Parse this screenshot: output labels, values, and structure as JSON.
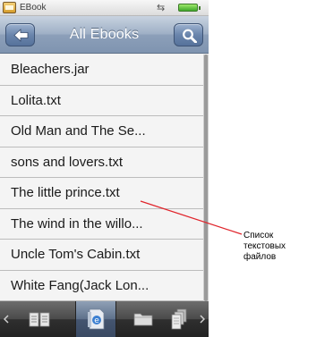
{
  "status_bar": {
    "app_title": "EBook"
  },
  "header": {
    "title": "All Ebooks"
  },
  "files": [
    {
      "name": "Bleachers.jar"
    },
    {
      "name": "Lolita.txt"
    },
    {
      "name": "Old Man and The Se..."
    },
    {
      "name": "sons and lovers.txt"
    },
    {
      "name": "The little prince.txt"
    },
    {
      "name": "The wind in the willo..."
    },
    {
      "name": "Uncle Tom's Cabin.txt"
    },
    {
      "name": "White Fang(Jack Lon..."
    }
  ],
  "annotation": {
    "label": "Список текстовых файлов"
  },
  "icons": {
    "back": "back-arrow-icon",
    "search": "search-icon",
    "bookshelf": "bookshelf-icon",
    "ebooks": "ebook-icon",
    "folder": "folder-icon",
    "batch": "document-stack-icon"
  },
  "colors": {
    "accent": "#7f94b0",
    "annotation_line": "#e0242b"
  }
}
